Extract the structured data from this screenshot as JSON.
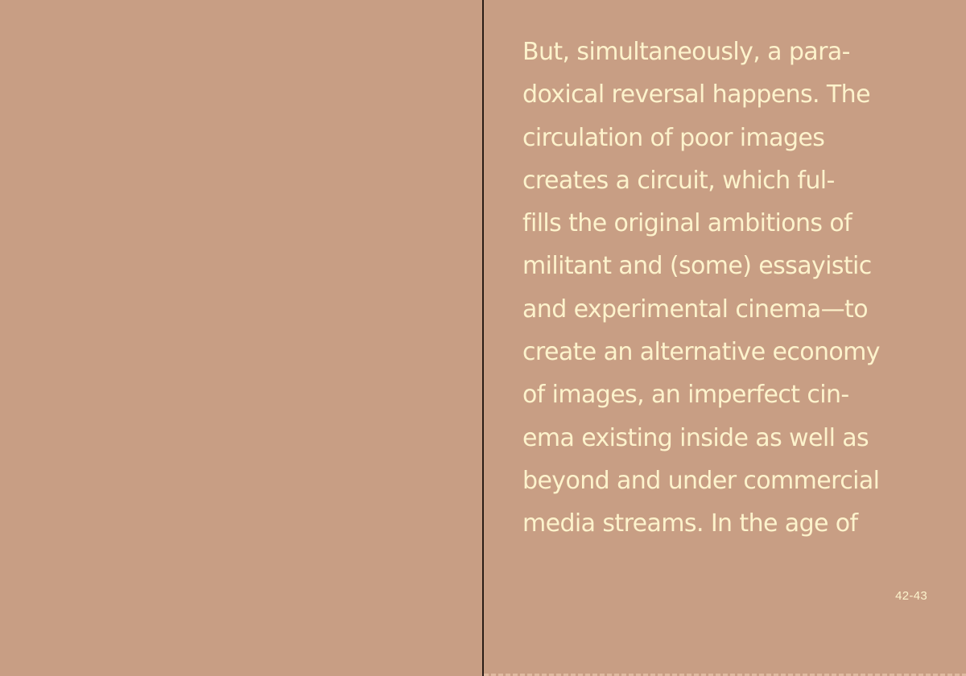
{
  "spread": {
    "left_page": {},
    "right_page": {
      "lines": [
        "But, simultaneously, a para-",
        "doxical reversal happens. The",
        "circulation of poor images",
        "creates a circuit, which ful-",
        "fills the original ambitions of",
        "militant and (some) essayistic",
        "and experimental cinema—to",
        "create an alternative economy",
        "of images, an imperfect cin-",
        "ema existing inside as well as",
        "beyond and under commercial",
        "media streams. In the age of"
      ],
      "folio": "42-43"
    }
  },
  "colors": {
    "paper": "#c89e84",
    "ink": "#fdf3cc",
    "gutter": "#2a1d16"
  }
}
